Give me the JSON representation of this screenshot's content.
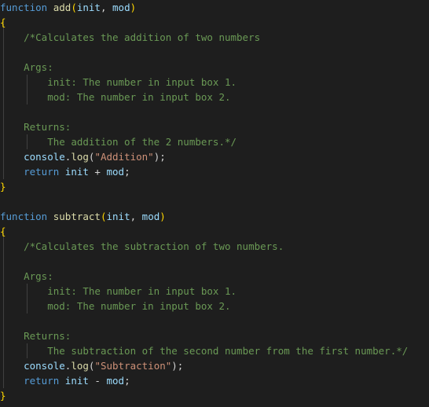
{
  "editor": {
    "lines": [
      [
        [
          "kw",
          "function"
        ],
        [
          "pl",
          " "
        ],
        [
          "fn",
          "add"
        ],
        [
          "br",
          "("
        ],
        [
          "pm",
          "init"
        ],
        [
          "pl",
          ", "
        ],
        [
          "pm",
          "mod"
        ],
        [
          "br",
          ")"
        ]
      ],
      [
        [
          "br",
          "{"
        ]
      ],
      [
        [
          "pl",
          "    "
        ],
        [
          "cm",
          "/*Calculates the addition of two numbers"
        ]
      ],
      [],
      [
        [
          "pl",
          "    "
        ],
        [
          "cm",
          "Args:"
        ]
      ],
      [
        [
          "pl",
          "        "
        ],
        [
          "cm",
          "init: The number in input box 1."
        ]
      ],
      [
        [
          "pl",
          "        "
        ],
        [
          "cm",
          "mod: The number in input box 2."
        ]
      ],
      [],
      [
        [
          "pl",
          "    "
        ],
        [
          "cm",
          "Returns:"
        ]
      ],
      [
        [
          "pl",
          "        "
        ],
        [
          "cm",
          "The addition of the 2 numbers.*/"
        ]
      ],
      [
        [
          "pl",
          "    "
        ],
        [
          "pm",
          "console"
        ],
        [
          "pl",
          "."
        ],
        [
          "fn",
          "log"
        ],
        [
          "pl",
          "("
        ],
        [
          "str",
          "\"Addition\""
        ],
        [
          "pl",
          ");"
        ]
      ],
      [
        [
          "pl",
          "    "
        ],
        [
          "kw",
          "return"
        ],
        [
          "pl",
          " "
        ],
        [
          "pm",
          "init"
        ],
        [
          "pl",
          " + "
        ],
        [
          "pm",
          "mod"
        ],
        [
          "pl",
          ";"
        ]
      ],
      [
        [
          "br",
          "}"
        ]
      ],
      [],
      [
        [
          "kw",
          "function"
        ],
        [
          "pl",
          " "
        ],
        [
          "fn",
          "subtract"
        ],
        [
          "br",
          "("
        ],
        [
          "pm",
          "init"
        ],
        [
          "pl",
          ", "
        ],
        [
          "pm",
          "mod"
        ],
        [
          "br",
          ")"
        ]
      ],
      [
        [
          "br",
          "{"
        ]
      ],
      [
        [
          "pl",
          "    "
        ],
        [
          "cm",
          "/*Calculates the subtraction of two numbers."
        ]
      ],
      [],
      [
        [
          "pl",
          "    "
        ],
        [
          "cm",
          "Args:"
        ]
      ],
      [
        [
          "pl",
          "        "
        ],
        [
          "cm",
          "init: The number in input box 1."
        ]
      ],
      [
        [
          "pl",
          "        "
        ],
        [
          "cm",
          "mod: The number in input box 2."
        ]
      ],
      [],
      [
        [
          "pl",
          "    "
        ],
        [
          "cm",
          "Returns:"
        ]
      ],
      [
        [
          "pl",
          "        "
        ],
        [
          "cm",
          "The subtraction of the second number from the first number.*/"
        ]
      ],
      [
        [
          "pl",
          "    "
        ],
        [
          "pm",
          "console"
        ],
        [
          "pl",
          "."
        ],
        [
          "fn",
          "log"
        ],
        [
          "pl",
          "("
        ],
        [
          "str",
          "\"Subtraction\""
        ],
        [
          "pl",
          ");"
        ]
      ],
      [
        [
          "pl",
          "    "
        ],
        [
          "kw",
          "return"
        ],
        [
          "pl",
          " "
        ],
        [
          "pm",
          "init"
        ],
        [
          "pl",
          " - "
        ],
        [
          "pm",
          "mod"
        ],
        [
          "pl",
          ";"
        ]
      ],
      [
        [
          "br",
          "}"
        ]
      ]
    ]
  },
  "colors": {
    "background": "#1e1e1e",
    "keyword": "#569cd6",
    "function": "#dcdcaa",
    "parameter": "#9cdcfe",
    "comment": "#6a9955",
    "string": "#ce9178",
    "bracket": "#ffd700"
  }
}
